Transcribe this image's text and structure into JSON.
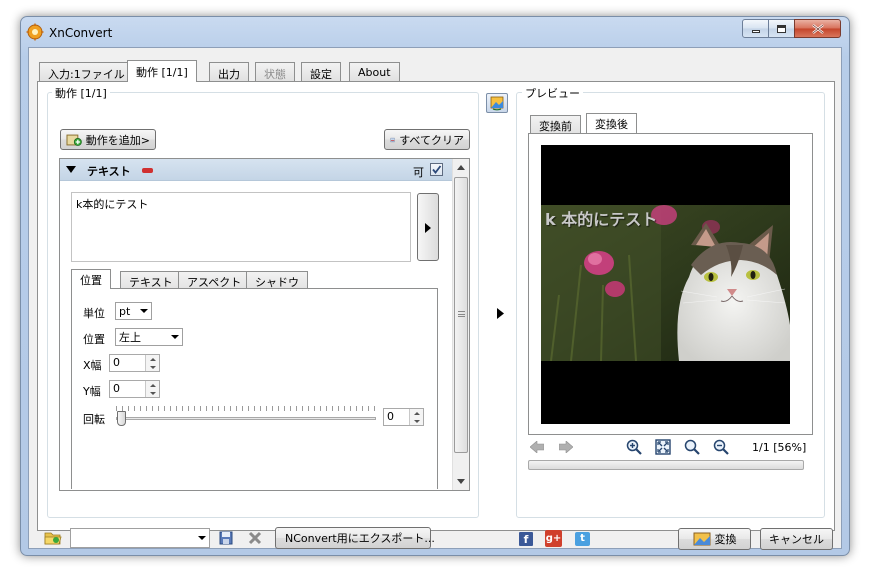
{
  "window": {
    "title": "XnConvert"
  },
  "tabs": [
    {
      "label": "入力:1ファイル",
      "state": "normal"
    },
    {
      "label": "動作 [1/1]",
      "state": "active"
    },
    {
      "label": "出力",
      "state": "normal"
    },
    {
      "label": "状態",
      "state": "disabled"
    },
    {
      "label": "設定",
      "state": "normal"
    },
    {
      "label": "About",
      "state": "normal"
    }
  ],
  "actions_panel": {
    "group_label": "動作 [1/1]",
    "add_button": "動作を追加>",
    "clear_button": "すべてクリア",
    "action": {
      "name": "テキスト",
      "enabled_label": "可",
      "text_value": "k本的にテスト"
    },
    "sub_tabs": [
      "位置",
      "テキスト",
      "アスペクト",
      "シャドウ"
    ],
    "fields": {
      "unit_label": "単位",
      "unit_value": "pt",
      "position_label": "位置",
      "position_value": "左上",
      "x_label": "X幅",
      "x_value": "0",
      "y_label": "Y幅",
      "y_value": "0",
      "rotation_label": "回転",
      "rotation_value": "0"
    }
  },
  "preview_panel": {
    "group_label": "プレビュー",
    "tabs": [
      "変換前",
      "変換後"
    ],
    "overlay_text": "k 本的にテスト",
    "zoom_status": "1/1 [56%]"
  },
  "bottom_bar": {
    "preset_value": "",
    "export_button": "NConvert用にエクスポート...",
    "convert_button": "変換",
    "cancel_button": "キャンセル"
  },
  "colors": {
    "accent_blue": "#3a6ea5",
    "section_header": "#c8d8e8",
    "remove_red": "#d03030"
  }
}
